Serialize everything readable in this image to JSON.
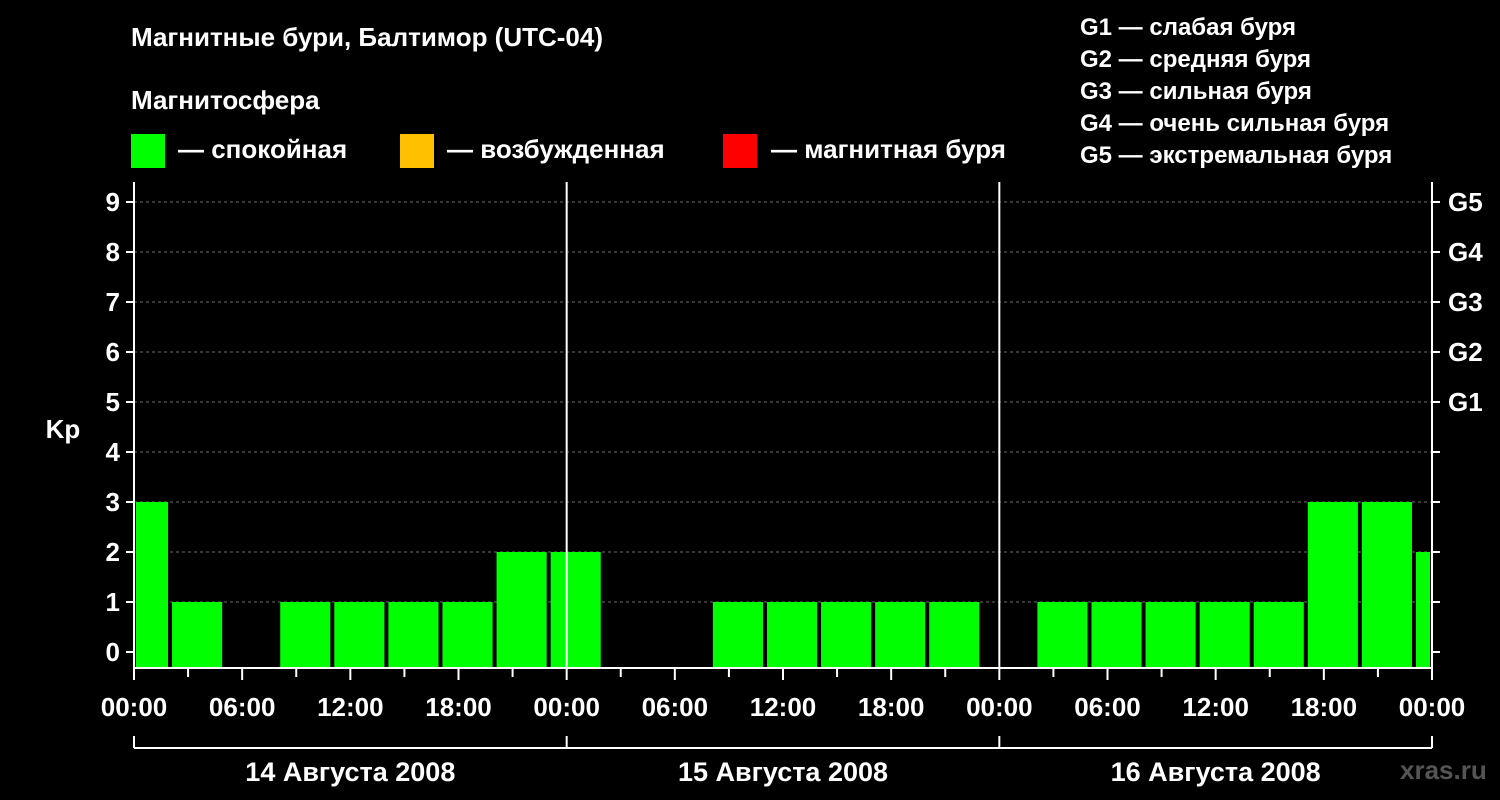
{
  "chart_data": {
    "type": "bar",
    "title": "Магнитные бури, Балтимор (UTC-04)",
    "ylabel": "Kp",
    "ylim": [
      0,
      9
    ],
    "y_ticks": [
      "0",
      "1",
      "2",
      "3",
      "4",
      "5",
      "6",
      "7",
      "8",
      "9"
    ],
    "g_scale": [
      {
        "label": "G1",
        "kp": 5
      },
      {
        "label": "G2",
        "kp": 6
      },
      {
        "label": "G3",
        "kp": 7
      },
      {
        "label": "G4",
        "kp": 8
      },
      {
        "label": "G5",
        "kp": 9
      }
    ],
    "x_tick_labels": [
      "00:00",
      "06:00",
      "12:00",
      "18:00",
      "00:00",
      "06:00",
      "12:00",
      "18:00",
      "00:00",
      "06:00",
      "12:00",
      "18:00",
      "00:00"
    ],
    "x_range_hours": [
      0,
      72
    ],
    "days": [
      "14 Августа 2008",
      "15 Августа 2008",
      "16 Августа 2008"
    ],
    "bars": [
      {
        "start_h": 0,
        "end_h": 2,
        "kp": 3
      },
      {
        "start_h": 2,
        "end_h": 5,
        "kp": 1
      },
      {
        "start_h": 8,
        "end_h": 11,
        "kp": 1
      },
      {
        "start_h": 11,
        "end_h": 14,
        "kp": 1
      },
      {
        "start_h": 14,
        "end_h": 17,
        "kp": 1
      },
      {
        "start_h": 17,
        "end_h": 20,
        "kp": 1
      },
      {
        "start_h": 20,
        "end_h": 23,
        "kp": 2
      },
      {
        "start_h": 23,
        "end_h": 26,
        "kp": 2
      },
      {
        "start_h": 32,
        "end_h": 35,
        "kp": 1
      },
      {
        "start_h": 35,
        "end_h": 38,
        "kp": 1
      },
      {
        "start_h": 38,
        "end_h": 41,
        "kp": 1
      },
      {
        "start_h": 41,
        "end_h": 44,
        "kp": 1
      },
      {
        "start_h": 44,
        "end_h": 47,
        "kp": 1
      },
      {
        "start_h": 50,
        "end_h": 53,
        "kp": 1
      },
      {
        "start_h": 53,
        "end_h": 56,
        "kp": 1
      },
      {
        "start_h": 56,
        "end_h": 59,
        "kp": 1
      },
      {
        "start_h": 59,
        "end_h": 62,
        "kp": 1
      },
      {
        "start_h": 62,
        "end_h": 65,
        "kp": 1
      },
      {
        "start_h": 65,
        "end_h": 68,
        "kp": 3
      },
      {
        "start_h": 68,
        "end_h": 71,
        "kp": 3
      },
      {
        "start_h": 71,
        "end_h": 72,
        "kp": 2
      }
    ],
    "bar_colors": {
      "quiet": "#00ff00",
      "active": "#ffc000",
      "storm": "#ff0000"
    },
    "grid": "dashed horizontal"
  },
  "legend": {
    "title": "Магнитосфера",
    "items": [
      {
        "label": "— спокойная",
        "color": "#00ff00"
      },
      {
        "label": "— возбужденная",
        "color": "#ffc000"
      },
      {
        "label": "— магнитная буря",
        "color": "#ff0000"
      }
    ]
  },
  "g_legend": [
    "G1 — слабая буря",
    "G2 — средняя буря",
    "G3 — сильная буря",
    "G4 — очень сильная буря",
    "G5 — экстремальная буря"
  ],
  "watermark": "xras.ru"
}
